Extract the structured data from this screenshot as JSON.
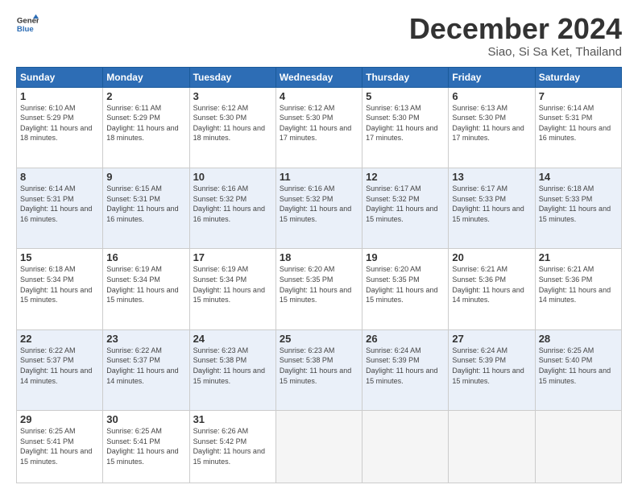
{
  "logo": {
    "line1": "General",
    "line2": "Blue"
  },
  "header": {
    "month": "December 2024",
    "location": "Siao, Si Sa Ket, Thailand"
  },
  "weekdays": [
    "Sunday",
    "Monday",
    "Tuesday",
    "Wednesday",
    "Thursday",
    "Friday",
    "Saturday"
  ],
  "weeks": [
    [
      {
        "day": "1",
        "sunrise": "Sunrise: 6:10 AM",
        "sunset": "Sunset: 5:29 PM",
        "daylight": "Daylight: 11 hours and 18 minutes."
      },
      {
        "day": "2",
        "sunrise": "Sunrise: 6:11 AM",
        "sunset": "Sunset: 5:29 PM",
        "daylight": "Daylight: 11 hours and 18 minutes."
      },
      {
        "day": "3",
        "sunrise": "Sunrise: 6:12 AM",
        "sunset": "Sunset: 5:30 PM",
        "daylight": "Daylight: 11 hours and 18 minutes."
      },
      {
        "day": "4",
        "sunrise": "Sunrise: 6:12 AM",
        "sunset": "Sunset: 5:30 PM",
        "daylight": "Daylight: 11 hours and 17 minutes."
      },
      {
        "day": "5",
        "sunrise": "Sunrise: 6:13 AM",
        "sunset": "Sunset: 5:30 PM",
        "daylight": "Daylight: 11 hours and 17 minutes."
      },
      {
        "day": "6",
        "sunrise": "Sunrise: 6:13 AM",
        "sunset": "Sunset: 5:30 PM",
        "daylight": "Daylight: 11 hours and 17 minutes."
      },
      {
        "day": "7",
        "sunrise": "Sunrise: 6:14 AM",
        "sunset": "Sunset: 5:31 PM",
        "daylight": "Daylight: 11 hours and 16 minutes."
      }
    ],
    [
      {
        "day": "8",
        "sunrise": "Sunrise: 6:14 AM",
        "sunset": "Sunset: 5:31 PM",
        "daylight": "Daylight: 11 hours and 16 minutes."
      },
      {
        "day": "9",
        "sunrise": "Sunrise: 6:15 AM",
        "sunset": "Sunset: 5:31 PM",
        "daylight": "Daylight: 11 hours and 16 minutes."
      },
      {
        "day": "10",
        "sunrise": "Sunrise: 6:16 AM",
        "sunset": "Sunset: 5:32 PM",
        "daylight": "Daylight: 11 hours and 16 minutes."
      },
      {
        "day": "11",
        "sunrise": "Sunrise: 6:16 AM",
        "sunset": "Sunset: 5:32 PM",
        "daylight": "Daylight: 11 hours and 15 minutes."
      },
      {
        "day": "12",
        "sunrise": "Sunrise: 6:17 AM",
        "sunset": "Sunset: 5:32 PM",
        "daylight": "Daylight: 11 hours and 15 minutes."
      },
      {
        "day": "13",
        "sunrise": "Sunrise: 6:17 AM",
        "sunset": "Sunset: 5:33 PM",
        "daylight": "Daylight: 11 hours and 15 minutes."
      },
      {
        "day": "14",
        "sunrise": "Sunrise: 6:18 AM",
        "sunset": "Sunset: 5:33 PM",
        "daylight": "Daylight: 11 hours and 15 minutes."
      }
    ],
    [
      {
        "day": "15",
        "sunrise": "Sunrise: 6:18 AM",
        "sunset": "Sunset: 5:34 PM",
        "daylight": "Daylight: 11 hours and 15 minutes."
      },
      {
        "day": "16",
        "sunrise": "Sunrise: 6:19 AM",
        "sunset": "Sunset: 5:34 PM",
        "daylight": "Daylight: 11 hours and 15 minutes."
      },
      {
        "day": "17",
        "sunrise": "Sunrise: 6:19 AM",
        "sunset": "Sunset: 5:34 PM",
        "daylight": "Daylight: 11 hours and 15 minutes."
      },
      {
        "day": "18",
        "sunrise": "Sunrise: 6:20 AM",
        "sunset": "Sunset: 5:35 PM",
        "daylight": "Daylight: 11 hours and 15 minutes."
      },
      {
        "day": "19",
        "sunrise": "Sunrise: 6:20 AM",
        "sunset": "Sunset: 5:35 PM",
        "daylight": "Daylight: 11 hours and 15 minutes."
      },
      {
        "day": "20",
        "sunrise": "Sunrise: 6:21 AM",
        "sunset": "Sunset: 5:36 PM",
        "daylight": "Daylight: 11 hours and 14 minutes."
      },
      {
        "day": "21",
        "sunrise": "Sunrise: 6:21 AM",
        "sunset": "Sunset: 5:36 PM",
        "daylight": "Daylight: 11 hours and 14 minutes."
      }
    ],
    [
      {
        "day": "22",
        "sunrise": "Sunrise: 6:22 AM",
        "sunset": "Sunset: 5:37 PM",
        "daylight": "Daylight: 11 hours and 14 minutes."
      },
      {
        "day": "23",
        "sunrise": "Sunrise: 6:22 AM",
        "sunset": "Sunset: 5:37 PM",
        "daylight": "Daylight: 11 hours and 14 minutes."
      },
      {
        "day": "24",
        "sunrise": "Sunrise: 6:23 AM",
        "sunset": "Sunset: 5:38 PM",
        "daylight": "Daylight: 11 hours and 15 minutes."
      },
      {
        "day": "25",
        "sunrise": "Sunrise: 6:23 AM",
        "sunset": "Sunset: 5:38 PM",
        "daylight": "Daylight: 11 hours and 15 minutes."
      },
      {
        "day": "26",
        "sunrise": "Sunrise: 6:24 AM",
        "sunset": "Sunset: 5:39 PM",
        "daylight": "Daylight: 11 hours and 15 minutes."
      },
      {
        "day": "27",
        "sunrise": "Sunrise: 6:24 AM",
        "sunset": "Sunset: 5:39 PM",
        "daylight": "Daylight: 11 hours and 15 minutes."
      },
      {
        "day": "28",
        "sunrise": "Sunrise: 6:25 AM",
        "sunset": "Sunset: 5:40 PM",
        "daylight": "Daylight: 11 hours and 15 minutes."
      }
    ],
    [
      {
        "day": "29",
        "sunrise": "Sunrise: 6:25 AM",
        "sunset": "Sunset: 5:41 PM",
        "daylight": "Daylight: 11 hours and 15 minutes."
      },
      {
        "day": "30",
        "sunrise": "Sunrise: 6:25 AM",
        "sunset": "Sunset: 5:41 PM",
        "daylight": "Daylight: 11 hours and 15 minutes."
      },
      {
        "day": "31",
        "sunrise": "Sunrise: 6:26 AM",
        "sunset": "Sunset: 5:42 PM",
        "daylight": "Daylight: 11 hours and 15 minutes."
      },
      null,
      null,
      null,
      null
    ]
  ]
}
